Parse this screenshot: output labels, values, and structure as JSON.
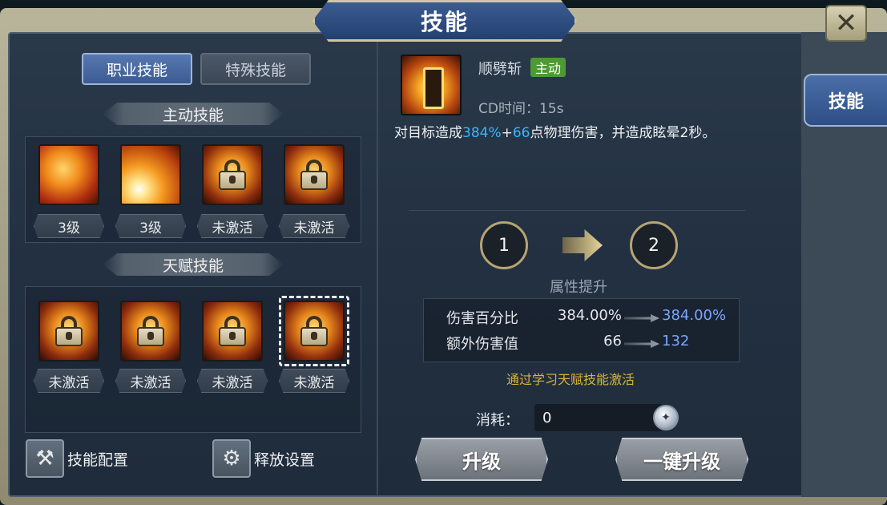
{
  "window": {
    "title": "技能",
    "close_icon": "close-icon"
  },
  "side_tabs": [
    {
      "label": "技能"
    }
  ],
  "left": {
    "tabs": [
      {
        "label": "职业技能",
        "active": true
      },
      {
        "label": "特殊技能",
        "active": false
      }
    ],
    "active_section": {
      "title": "主动技能",
      "skills": [
        {
          "status": "3级",
          "locked": false
        },
        {
          "status": "3级",
          "locked": false
        },
        {
          "status": "未激活",
          "locked": true
        },
        {
          "status": "未激活",
          "locked": true
        }
      ]
    },
    "talent_section": {
      "title": "天赋技能",
      "skills": [
        {
          "status": "未激活",
          "locked": true
        },
        {
          "status": "未激活",
          "locked": true
        },
        {
          "status": "未激活",
          "locked": true
        },
        {
          "status": "未激活",
          "locked": true,
          "selected": true
        }
      ]
    },
    "bottom_buttons": [
      {
        "label": "技能配置",
        "icon": "skill-config-icon"
      },
      {
        "label": "释放设置",
        "icon": "gear-icon"
      }
    ]
  },
  "detail": {
    "skill_name": "顺劈斩",
    "badge": "主动",
    "cd": "CD时间：15s",
    "desc_prefix": "对目标造成",
    "desc_pct": "384%",
    "desc_plus": "+",
    "desc_flat": "66",
    "desc_suffix": "点物理伤害，并造成眩晕2秒。",
    "level_from": "1",
    "level_to": "2",
    "attr_title": "属性提升",
    "stats": [
      {
        "name": "伤害百分比",
        "current": "384.00%",
        "next": "384.00%"
      },
      {
        "name": "额外伤害值",
        "current": "66",
        "next": "132"
      }
    ],
    "unlock_hint": "通过学习天赋技能激活",
    "cost_label": "消耗：",
    "cost_value": "0",
    "upgrade_label": "升级",
    "upgrade_all_label": "一键升级"
  },
  "colors": {
    "accent_blue": "#3ab5ff",
    "next_value": "#7aa6ff",
    "hint_gold": "#d9b43a",
    "badge_green": "#4d9a35"
  }
}
